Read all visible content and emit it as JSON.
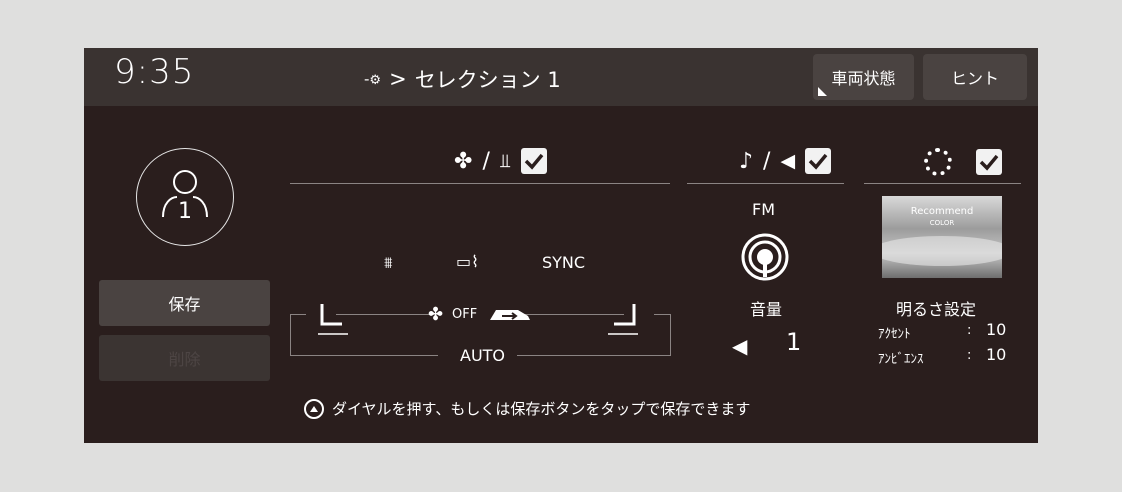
{
  "topbar": {
    "clock": "9:35",
    "breadcrumb_arrow": ">",
    "breadcrumb_title": "セレクション 1",
    "vehicle_status_label": "車両状態",
    "hint_label": "ヒント"
  },
  "profile": {
    "number": "1",
    "save_label": "保存",
    "delete_label": "削除"
  },
  "climate": {
    "sync_label": "SYNC",
    "fan_off_label": "OFF",
    "auto_label": "AUTO",
    "checked": true
  },
  "audio": {
    "source_label": "FM",
    "volume_label": "音量",
    "volume_value": "1",
    "checked": true
  },
  "display": {
    "thumbnail_title": "Recommend",
    "thumbnail_subtitle": "COLOR",
    "brightness_label": "明るさ設定",
    "accent_label": "ｱｸｾﾝﾄ",
    "accent_sep": ":",
    "accent_value": "10",
    "ambient_label": "ｱﾝﾋﾞｴﾝｽ",
    "ambient_sep": ":",
    "ambient_value": "10",
    "checked": true
  },
  "footer": {
    "instruction": "ダイヤルを押す、もしくは保存ボタンをタップで保存できます"
  },
  "colors": {
    "background": "#2a1e1d",
    "topbar": "#3a3331",
    "button": "#4a4341",
    "page": "#dfdfde"
  }
}
